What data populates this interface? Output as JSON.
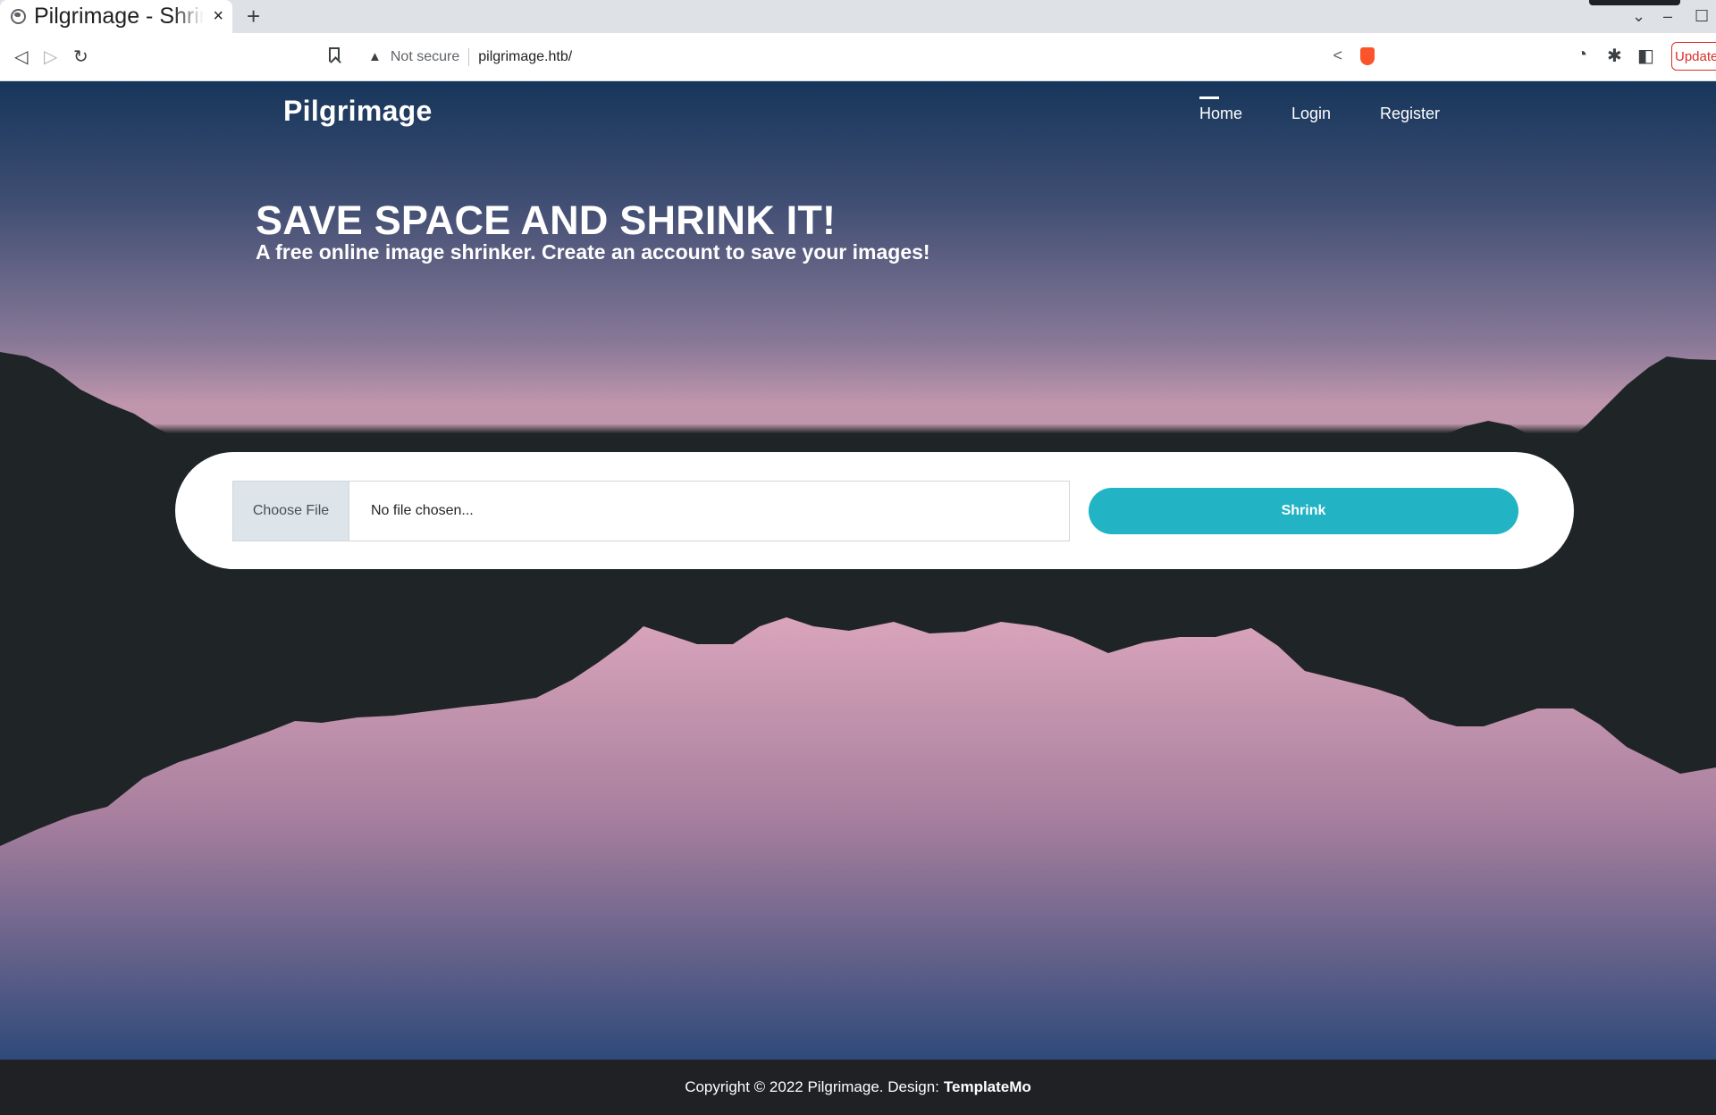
{
  "browser": {
    "tab": {
      "title": "Pilgrimage - Shrink Your Images",
      "close": "×"
    },
    "new_tab": "+",
    "address_bar": {
      "security_label": "Not secure",
      "url": "pilgrimage.htb/"
    },
    "update_label": "Update"
  },
  "site": {
    "brand": "Pilgrimage",
    "nav": [
      {
        "label": "Home",
        "active": true
      },
      {
        "label": "Login",
        "active": false
      },
      {
        "label": "Register",
        "active": false
      }
    ],
    "hero": {
      "title": "SAVE SPACE AND SHRINK IT!",
      "subtitle": "A free online image shrinker. Create an account to save your images!"
    },
    "upload": {
      "choose_file_label": "Choose File",
      "file_status": "No file chosen...",
      "submit_label": "Shrink"
    },
    "footer": {
      "copyright": "Copyright © 2022 Pilgrimage. Design:",
      "credit": "TemplateMo"
    }
  },
  "colors": {
    "accent": "#22b3c4",
    "sky_top": "#17365b",
    "sky_bottom": "#c096ad",
    "mountain": "#1f2527",
    "reflection": "#d9a5bb",
    "footer_bg": "#1f2124"
  },
  "icons": [
    "globe-icon",
    "back-icon",
    "forward-icon",
    "reload-icon",
    "bookmark-icon",
    "warning-icon",
    "share-icon",
    "brave-shield-icon",
    "extension-icon",
    "puzzle-icon",
    "sidebar-icon"
  ]
}
